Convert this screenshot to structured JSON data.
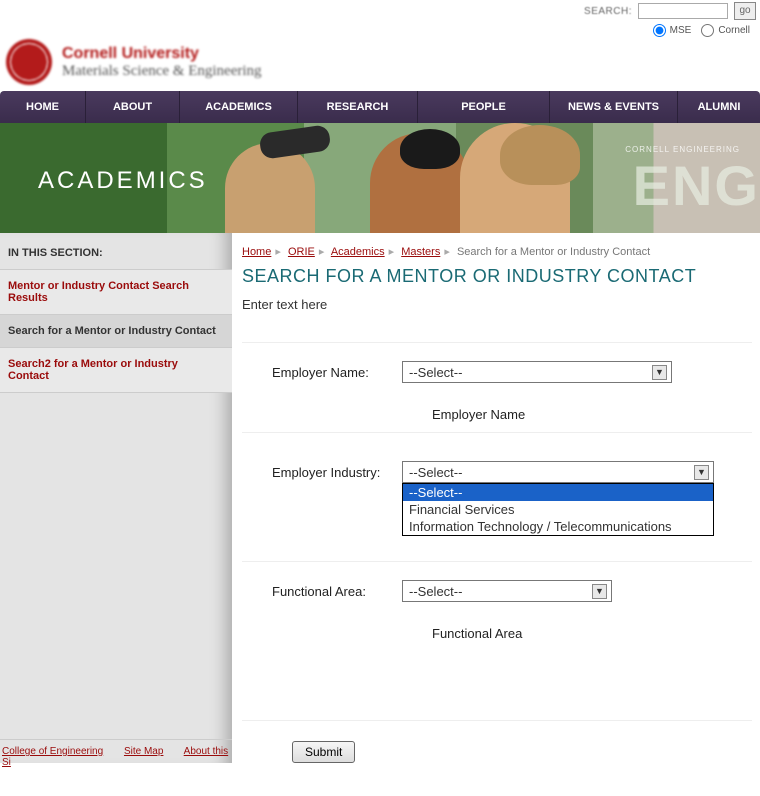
{
  "topbar": {
    "search_label": "SEARCH:",
    "go_label": "go",
    "radio_mse": "MSE",
    "radio_cornell": "Cornell"
  },
  "identity": {
    "university": "Cornell University",
    "department": "Materials Science & Engineering"
  },
  "nav": {
    "home": "HOME",
    "about": "ABOUT",
    "academics": "ACADEMICS",
    "research": "RESEARCH",
    "people": "PEOPLE",
    "news": "NEWS & EVENTS",
    "alumni": "ALUMNI"
  },
  "banner": {
    "title": "ACADEMICS",
    "eng": "ENG",
    "eng_sub": "CORNELL ENGINEERING"
  },
  "sidebar": {
    "heading": "IN THIS SECTION:",
    "items": [
      {
        "label": "Mentor or Industry Contact Search Results"
      },
      {
        "label": "Search for a Mentor or Industry Contact"
      },
      {
        "label": "Search2 for a Mentor or Industry Contact"
      }
    ]
  },
  "crumbs": {
    "home": "Home",
    "orie": "ORIE",
    "academics": "Academics",
    "masters": "Masters",
    "current": "Search for a Mentor or Industry Contact"
  },
  "page": {
    "title": "SEARCH FOR A MENTOR OR INDUSTRY CONTACT",
    "intro": "Enter text here"
  },
  "form": {
    "employer_name": {
      "label": "Employer Name:",
      "selected": "--Select--",
      "helper": "Employer Name"
    },
    "employer_industry": {
      "label": "Employer Industry:",
      "selected": "--Select--",
      "options": [
        "--Select--",
        "Financial Services",
        "Information Technology / Telecommunications"
      ]
    },
    "functional_area": {
      "label": "Functional Area:",
      "selected": "--Select--",
      "helper": "Functional Area"
    },
    "submit": "Submit"
  },
  "footer": {
    "coe": "College of Engineering",
    "sitemap": "Site Map",
    "about": "About this Si"
  }
}
